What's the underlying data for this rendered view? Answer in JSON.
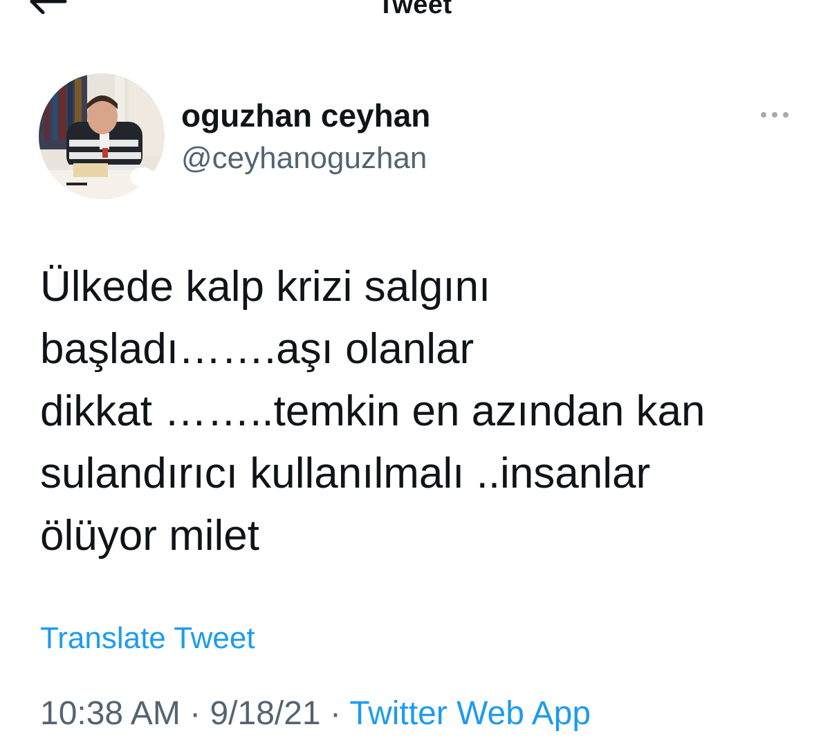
{
  "header": {
    "title": "Tweet",
    "back_icon": "arrow-left-icon"
  },
  "author": {
    "display_name": "oguzhan ceyhan",
    "handle": "@ceyhanoguzhan",
    "more_icon": "more-horizontal-icon"
  },
  "tweet": {
    "lines": [
      "Ülkede kalp krizi salgını",
      "başladı…….aşı olanlar",
      "dikkat ……..temkin en azından kan",
      "sulandırıcı kullanılmalı ..insanlar",
      "ölüyor milet"
    ],
    "translate_label": "Translate Tweet"
  },
  "meta": {
    "time": "10:38 AM",
    "separator": " · ",
    "date": "9/18/21",
    "source": "Twitter Web App"
  },
  "colors": {
    "accent": "#1d9bf0",
    "secondary_text": "#536471",
    "primary_text": "#0f1419"
  }
}
